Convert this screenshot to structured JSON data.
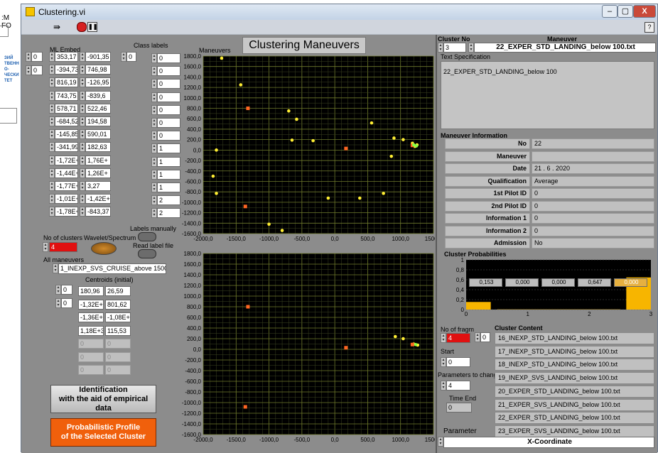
{
  "background_app": {
    "menu_fragment": ":М FO",
    "side_text": [
      "ЗИЙ",
      "ТВЕНН",
      "О-",
      "ЧЕСКИ",
      "ТЕТ"
    ]
  },
  "window": {
    "title": "Clustering.vi",
    "minimize": "–",
    "maximize": "▢",
    "close": "X",
    "help": "?"
  },
  "front_panel": {
    "title": "Clustering Maneuvers",
    "ml_embed": {
      "label": "ML Embed",
      "index_row": "0",
      "index_col": "0",
      "col1": [
        "353,17",
        "-394,73",
        "816,19",
        "743,75",
        "578,71",
        "-684,52",
        "-145,85",
        "-341,99",
        "-1,72E+",
        "-1,44E+",
        "-1,77E+",
        "-1,01E+",
        "-1,78E+"
      ],
      "col2": [
        "-901,35",
        "746,98",
        "-126,95",
        "-839,6",
        "522,46",
        "194,58",
        "590,01",
        "182,63",
        "1,76E+",
        "1,26E+",
        "3,27",
        "-1,42E+",
        "-843,37"
      ]
    },
    "class_labels": {
      "label": "Class labels",
      "index": "0",
      "values": [
        "0",
        "0",
        "0",
        "0",
        "0",
        "0",
        "0",
        "1",
        "1",
        "1",
        "1",
        "2",
        "2"
      ]
    },
    "labels_manually": "Labels manually",
    "read_label_file": "Read label file",
    "no_of_clusters": {
      "label": "No of clusters",
      "value": "4"
    },
    "wavelet_spectrum": "Wavelet/Spectrum",
    "all_maneuvers": {
      "label": "All maneuvers",
      "value": "1_INEXP_SVS_CRUISE_above 1500.txt"
    },
    "centroids": {
      "label": "Centroids (initial)",
      "index_row": "0",
      "index_col": "0",
      "rows": [
        [
          "180,96",
          "26,59"
        ],
        [
          "-1,32E+:",
          "801,62"
        ],
        [
          "-1,36E+:",
          "-1,08E+:"
        ],
        [
          "1,18E+3",
          "115,53"
        ],
        [
          "0",
          "0"
        ],
        [
          "0",
          "0"
        ],
        [
          "0",
          "0"
        ]
      ]
    },
    "btn_identification": "Identification\nwith the aid of empirical data",
    "btn_profile": "Probabilistic Profile\nof the Selected Cluster",
    "plot_label": "Maneuvers",
    "plot_yticks": [
      "1800,0",
      "1600,0",
      "1400,0",
      "1200,0",
      "1000,0",
      "800,0",
      "600,0",
      "400,0",
      "200,0",
      "0,0",
      "-200,0",
      "-400,0",
      "-600,0",
      "-800,0",
      "-1000,0",
      "-1200,0",
      "-1400,0",
      "-1600,0"
    ],
    "plot_xticks": [
      "-2000,0",
      "-1500,0",
      "-1000,0",
      "-500,0",
      "0,0",
      "500,0",
      "1000,0",
      "1500,0"
    ]
  },
  "chart_data": [
    {
      "type": "scatter",
      "xlim": [
        -2000,
        1500
      ],
      "ylim": [
        -1600,
        1800
      ],
      "grid": true,
      "series": [
        {
          "color": "#ffee33",
          "points": [
            [
              -1720,
              1760
            ],
            [
              -1430,
              1250
            ],
            [
              -700,
              750
            ],
            [
              -580,
              590
            ],
            [
              -650,
              190
            ],
            [
              -330,
              180
            ],
            [
              -1800,
              0
            ],
            [
              -1850,
              -500
            ],
            [
              -1800,
              -830
            ],
            [
              -100,
              -920
            ],
            [
              560,
              520
            ],
            [
              900,
              230
            ],
            [
              1040,
              200
            ],
            [
              860,
              -120
            ],
            [
              740,
              -830
            ],
            [
              380,
              -920
            ],
            [
              -1000,
              -1420
            ],
            [
              -800,
              -1540
            ],
            [
              1180,
              130
            ],
            [
              1220,
              70
            ],
            [
              1250,
              100
            ]
          ]
        },
        {
          "color": "#ff6622",
          "points": [
            [
              -1320,
              800
            ],
            [
              170,
              30
            ],
            [
              1180,
              90
            ],
            [
              -1360,
              -1080
            ]
          ]
        },
        {
          "color": "#88ff44",
          "points": [
            [
              1200,
              100
            ],
            [
              1240,
              80
            ]
          ]
        }
      ]
    },
    {
      "type": "scatter",
      "xlim": [
        -2000,
        1500
      ],
      "ylim": [
        -1600,
        1800
      ],
      "grid": true,
      "series": [
        {
          "color": "#ffee33",
          "points": [
            [
              920,
              240
            ],
            [
              1040,
              200
            ],
            [
              1200,
              100
            ],
            [
              1260,
              80
            ]
          ]
        },
        {
          "color": "#ff6622",
          "points": [
            [
              -1320,
              800
            ],
            [
              170,
              30
            ],
            [
              1180,
              90
            ],
            [
              -1360,
              -1080
            ]
          ]
        },
        {
          "color": "#88ff44",
          "points": [
            [
              1230,
              90
            ]
          ]
        }
      ]
    },
    {
      "type": "bar",
      "title": "Cluster Probabilities",
      "categories": [
        "0",
        "1",
        "2",
        "3"
      ],
      "values": [
        0.153,
        0.0,
        0.0,
        0.647
      ],
      "values_boxes": [
        "0,153",
        "0,000",
        "0,000",
        "0,647",
        "0,000"
      ],
      "ylim": [
        0,
        1
      ],
      "xticks": [
        "0",
        "1",
        "2",
        "3"
      ],
      "yticks": [
        "1",
        "0,8",
        "0,6",
        "0,4",
        "0,2",
        "0"
      ],
      "bar_color": "#f7b500"
    }
  ],
  "right_panel": {
    "cluster_no": {
      "label": "Cluster No",
      "value": "3"
    },
    "maneuver": {
      "label": "Maneuver",
      "value": "22_EXPER_STD_LANDING_below 100.txt"
    },
    "text_spec": {
      "label": "Text Specification",
      "value": "22_EXPER_STD_LANDING_below 100"
    },
    "info_title": "Maneuver Information",
    "info": [
      {
        "label": "No",
        "value": "22"
      },
      {
        "label": "Maneuver",
        "value": ""
      },
      {
        "label": "Date",
        "value": "21 . 6 . 2020"
      },
      {
        "label": "Qualification",
        "value": "Average"
      },
      {
        "label": "1st Pilot ID",
        "value": "0"
      },
      {
        "label": "2nd Pilot ID",
        "value": "0"
      },
      {
        "label": "Information 1",
        "value": "0"
      },
      {
        "label": "Information 2",
        "value": "0"
      },
      {
        "label": "Admission",
        "value": "No"
      }
    ],
    "no_of_fragm": {
      "label": "No of fragm",
      "value": "4",
      "index": "0"
    },
    "start": {
      "label": "Start",
      "value": "0"
    },
    "params_to_change": {
      "label": "Parameters to change",
      "value": "4"
    },
    "time_end": {
      "label": "Time End",
      "value": "0"
    },
    "cluster_content": {
      "label": "Cluster Content",
      "items": [
        "16_INEXP_STD_LANDING_below 100.txt",
        "17_INEXP_STD_LANDING_below 100.txt",
        "18_INEXP_STD_LANDING_below 100.txt",
        "19_INEXP_SVS_LANDING_below 100.txt",
        "20_EXPER_STD_LANDING_below 100.txt",
        "21_EXPER_SVS_LANDING_below 100.txt",
        "22_EXPER_STD_LANDING_below 100.txt",
        "23_EXPER_SVS_LANDING_below 100.txt"
      ]
    },
    "parameter": {
      "label": "Parameter",
      "value": "X-Coordinate"
    }
  }
}
